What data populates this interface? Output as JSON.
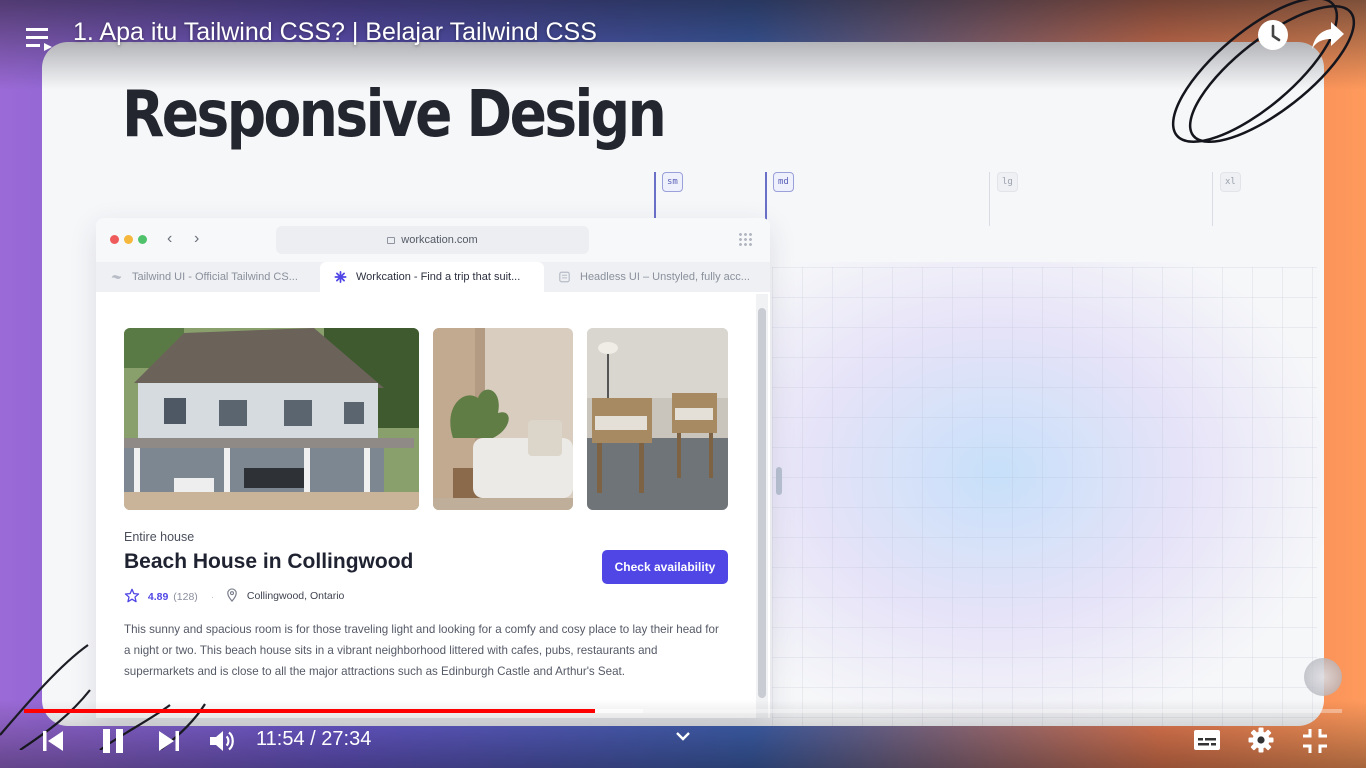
{
  "video": {
    "title": "1. Apa itu Tailwind CSS? | Belajar Tailwind CSS",
    "current_time": "11:54",
    "separator": "/",
    "duration": "27:34",
    "progress": 0.433,
    "buffered": 0.47
  },
  "slide": {
    "heading": "Responsive Design",
    "breakpoints": [
      "sm",
      "md",
      "lg",
      "xl"
    ]
  },
  "browser": {
    "url": "workcation.com",
    "tabs": [
      "Tailwind UI - Official Tailwind CS...",
      "Workcation - Find a trip that suit...",
      "Headless UI – Unstyled, fully acc..."
    ]
  },
  "listing": {
    "kicker": "Entire house",
    "title": "Beach House in Collingwood",
    "cta_label": "Check availability",
    "rating": "4.89",
    "reviews": "(128)",
    "location": "Collingwood, Ontario",
    "description": "This sunny and spacious room is for those traveling light and looking for a comfy and cosy place to lay their head for a night or two. This beach house sits in a vibrant neighborhood littered with cafes, pubs, restaurants and supermarkets and is close to all the major attractions such as Edinburgh Castle and Arthur's Seat."
  },
  "colors": {
    "progress": "#ff0000",
    "cta": "#4f46e5",
    "brand_icon": "#4f46e5"
  },
  "icons": {
    "playlist": "playlist-icon",
    "watch_later": "clock-icon",
    "share": "share-icon",
    "prev": "previous-icon",
    "pause": "pause-icon",
    "next": "next-icon",
    "volume": "volume-icon",
    "chapters": "chevron-down-icon",
    "captions": "captions-icon",
    "settings": "gear-icon",
    "exit_fullscreen": "exit-fullscreen-icon"
  }
}
